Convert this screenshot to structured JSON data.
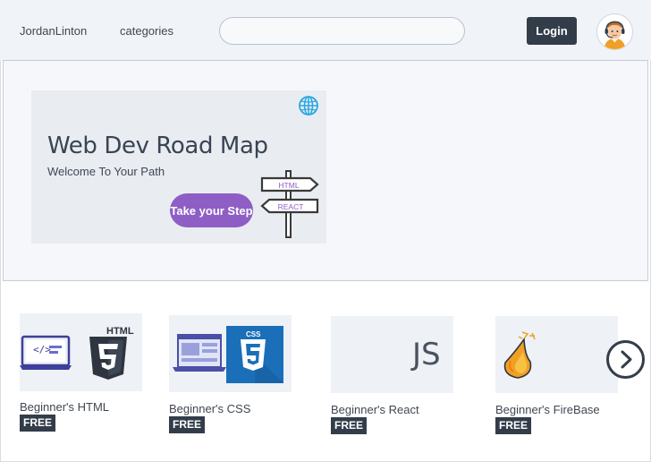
{
  "navbar": {
    "brand": "JordanLinton",
    "categories_label": "categories",
    "search_value": "",
    "search_placeholder": "",
    "login_label": "Login"
  },
  "hero": {
    "title": "Web Dev Road Map",
    "subtitle": "Welcome To Your Path",
    "cta_label": "Take your Step",
    "sign_labels": [
      "HTML",
      "REACT"
    ]
  },
  "courses": [
    {
      "title": "Beginner's HTML",
      "badge": "FREE",
      "icon": "html5-icon"
    },
    {
      "title": "Beginner's CSS",
      "badge": "FREE",
      "icon": "css3-icon"
    },
    {
      "title": "Beginner's React",
      "badge": "FREE",
      "icon": "js-icon",
      "thumb_text": "JS"
    },
    {
      "title": "Beginner's FireBase",
      "badge": "FREE",
      "icon": "firebase-icon"
    }
  ],
  "colors": {
    "navbar_bg": "#f0f3f7",
    "dark": "#333d4a",
    "accent_purple": "#8e5ec5",
    "globe_blue": "#2aa7e0",
    "css_blue": "#1a6fb8"
  }
}
